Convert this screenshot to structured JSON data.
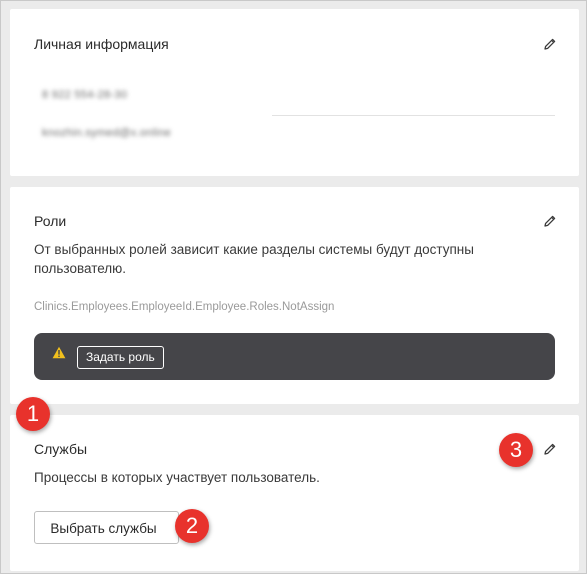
{
  "personal": {
    "title": "Личная информация",
    "phone": "8 922 554-28-30",
    "email": "knozhin.symed@x.online"
  },
  "roles": {
    "title": "Роли",
    "description": "От выбранных ролей зависит какие разделы системы будут доступны пользователю.",
    "placeholder_key": "Clinics.Employees.EmployeeId.Employee.Roles.NotAssign",
    "assign_button": "Задать роль"
  },
  "services": {
    "title": "Службы",
    "description": "Процессы в которых участвует пользователь.",
    "select_button": "Выбрать службы"
  },
  "annotations": {
    "badge1": "1",
    "badge2": "2",
    "badge3": "3"
  },
  "colors": {
    "accent_badge": "#e8322c",
    "alert_bg": "#454549",
    "warning": "#f2c01d"
  },
  "icons": {
    "edit": "pencil-icon",
    "warning": "warning-icon"
  }
}
